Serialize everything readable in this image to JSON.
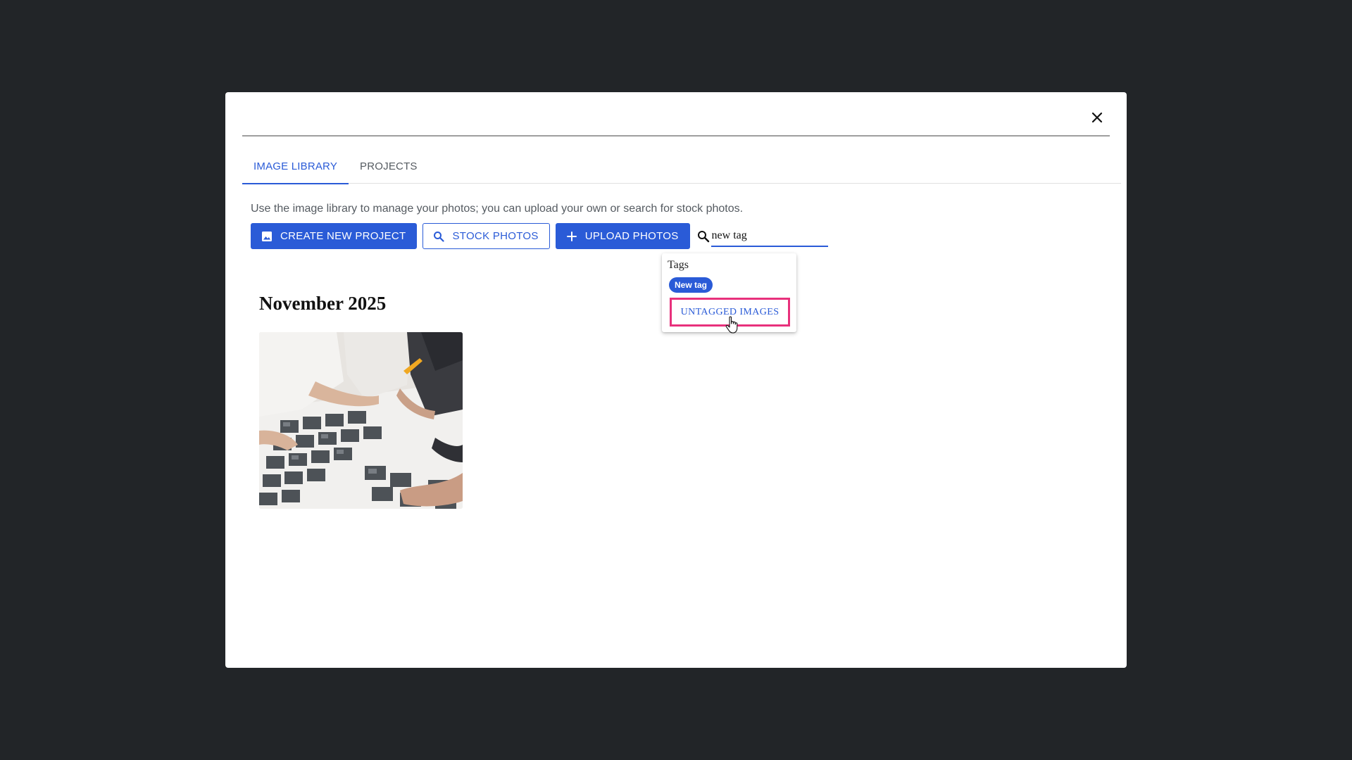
{
  "tabs": [
    {
      "label": "IMAGE LIBRARY",
      "active": true
    },
    {
      "label": "PROJECTS",
      "active": false
    }
  ],
  "intro_text": "Use the image library to manage your photos; you can upload your own or search for stock photos.",
  "toolbar": {
    "create_project": {
      "label": "CREATE NEW PROJECT",
      "icon": "image-icon"
    },
    "stock_photos": {
      "label": "STOCK PHOTOS",
      "icon": "search-icon"
    },
    "upload_photos": {
      "label": "UPLOAD PHOTOS",
      "icon": "plus-icon"
    }
  },
  "search": {
    "value": "new tag",
    "icon": "search-icon"
  },
  "dropdown": {
    "heading": "Tags",
    "chips": [
      "New tag"
    ],
    "untagged_label": "UNTAGGED IMAGES"
  },
  "gallery": {
    "group_label": "November 2025"
  },
  "colors": {
    "accent": "#2a5bd7",
    "highlight": "#e8317c",
    "backdrop": "#222528"
  }
}
